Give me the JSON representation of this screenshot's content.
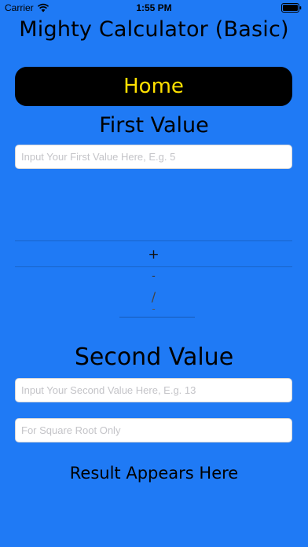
{
  "status_bar": {
    "carrier": "Carrier",
    "time": "1:55 PM",
    "wifi_icon": "wifi-icon",
    "battery_icon": "battery-icon"
  },
  "title": "Mighty Calculator (Basic)",
  "home_button": "Home",
  "first_value": {
    "label": "First Value",
    "placeholder": "Input Your First Value Here, E.g. 5",
    "value": ""
  },
  "operator_picker": {
    "options": [
      "+",
      "-",
      "/",
      "-"
    ],
    "selected": "+"
  },
  "second_value": {
    "label": "Second Value",
    "placeholder": "Input Your Second Value Here, E.g. 13",
    "value": ""
  },
  "square_root": {
    "placeholder": "For Square Root Only",
    "value": ""
  },
  "result": "Result Appears Here",
  "colors": {
    "background": "#1f7af5",
    "home_button_bg": "#000000",
    "home_button_text": "#ffe000"
  }
}
